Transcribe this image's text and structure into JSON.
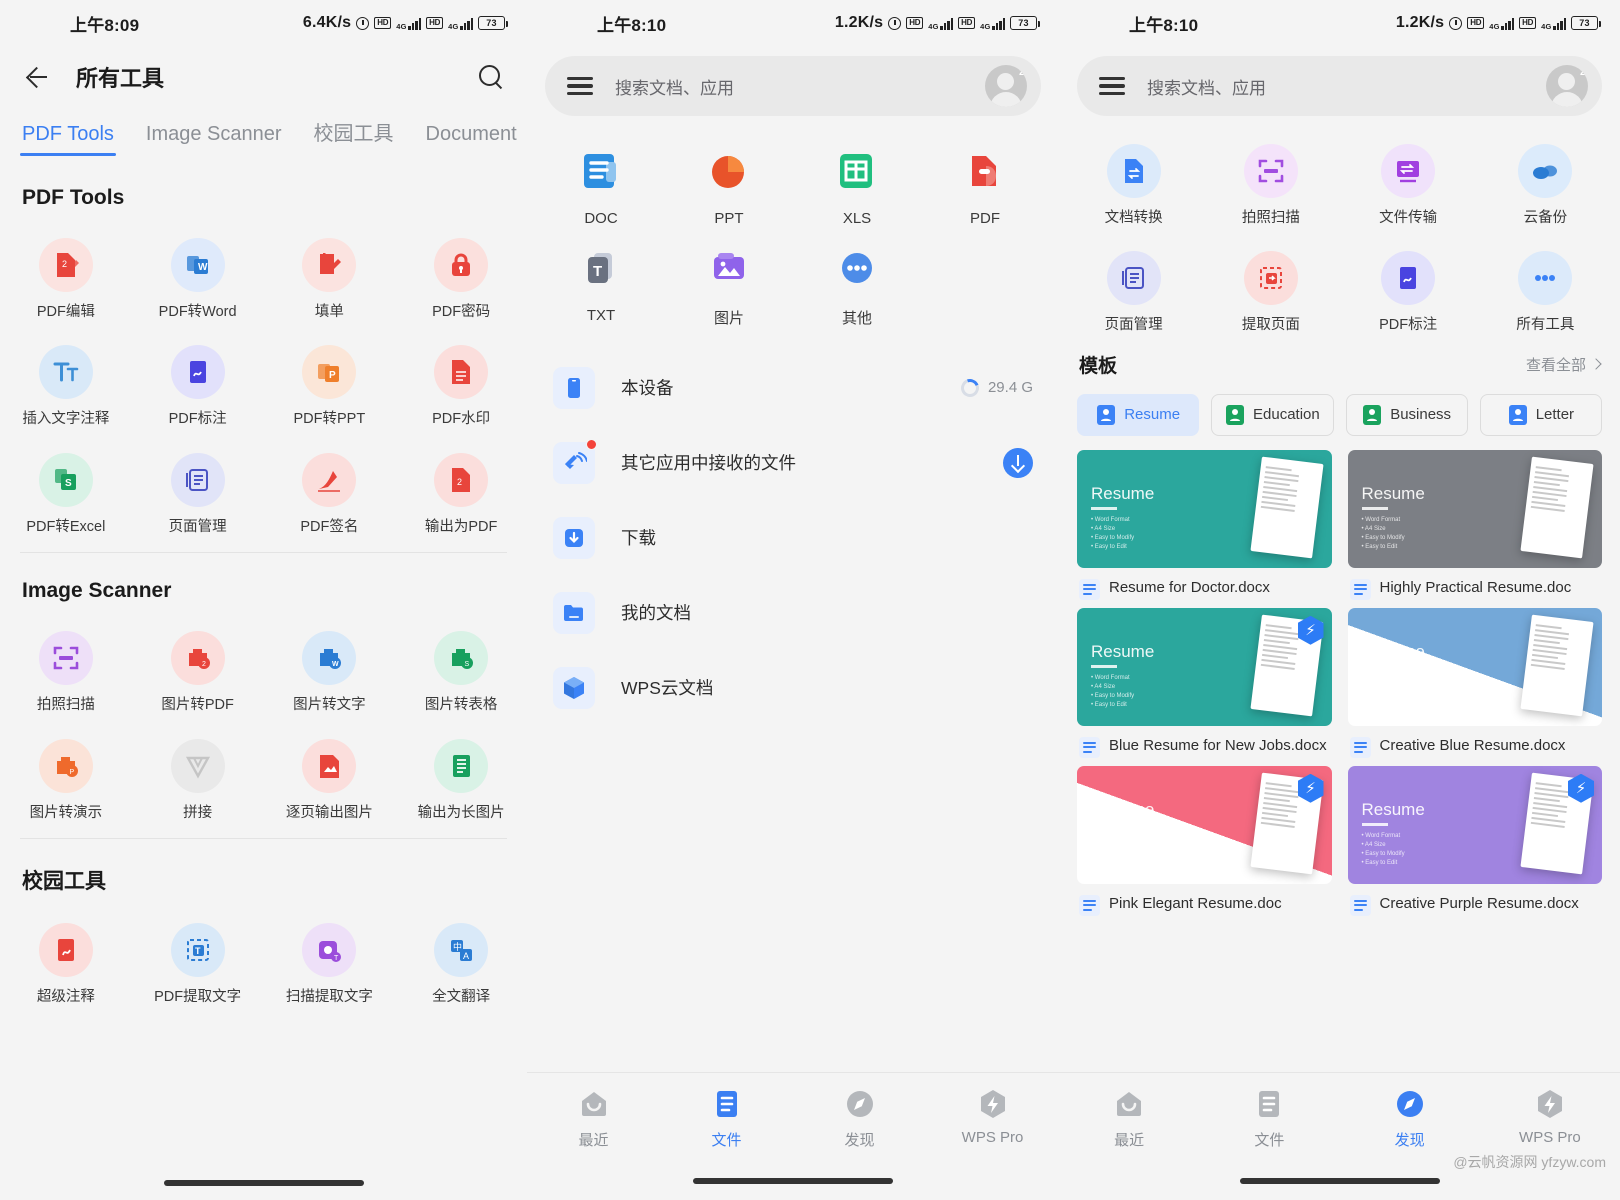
{
  "panel1": {
    "status": {
      "time": "上午8:09",
      "speed": "6.4K/s",
      "network1": "4G",
      "network2": "4G",
      "hd": "HD",
      "battery": "73"
    },
    "appbar": {
      "title": "所有工具",
      "back_icon": "back-arrow-icon",
      "search_icon": "search-icon"
    },
    "tabs": [
      {
        "label": "PDF Tools",
        "active": true
      },
      {
        "label": "Image Scanner",
        "active": false
      },
      {
        "label": "校园工具",
        "active": false
      },
      {
        "label": "Document",
        "active": false
      }
    ],
    "sections": [
      {
        "title": "PDF Tools",
        "tools": [
          {
            "label": "PDF编辑",
            "icon": "pdf-edit-icon",
            "bubble": "#fbe3e0",
            "color": "#e8453c"
          },
          {
            "label": "PDF转Word",
            "icon": "pdf-to-word-icon",
            "bubble": "#dfeafb",
            "color": "#2b7cd3"
          },
          {
            "label": "填单",
            "icon": "fill-form-icon",
            "bubble": "#fbe3e0",
            "color": "#e8453c"
          },
          {
            "label": "PDF密码",
            "icon": "lock-icon",
            "bubble": "#fbe0dd",
            "color": "#e8453c"
          },
          {
            "label": "插入文字注释",
            "icon": "insert-text-icon",
            "bubble": "#d9e9f8",
            "color": "#3d8fd6"
          },
          {
            "label": "PDF标注",
            "icon": "pdf-annotate-icon",
            "bubble": "#e2e1fb",
            "color": "#4a44e0"
          },
          {
            "label": "PDF转PPT",
            "icon": "pdf-to-ppt-icon",
            "bubble": "#fbe6d8",
            "color": "#ef7f2c"
          },
          {
            "label": "PDF水印",
            "icon": "watermark-icon",
            "bubble": "#fbdedc",
            "color": "#e8453c"
          },
          {
            "label": "PDF转Excel",
            "icon": "pdf-to-excel-icon",
            "bubble": "#d9f2e6",
            "color": "#18a05e"
          },
          {
            "label": "页面管理",
            "icon": "page-manage-icon",
            "bubble": "#e1e4f8",
            "color": "#4b54c4"
          },
          {
            "label": "PDF签名",
            "icon": "signature-icon",
            "bubble": "#fbdedc",
            "color": "#e8453c"
          },
          {
            "label": "输出为PDF",
            "icon": "export-pdf-icon",
            "bubble": "#fbdedc",
            "color": "#e8453c"
          }
        ]
      },
      {
        "title": "Image Scanner",
        "tools": [
          {
            "label": "拍照扫描",
            "icon": "scan-photo-icon",
            "bubble": "#eee0f8",
            "color": "#9b4ddb"
          },
          {
            "label": "图片转PDF",
            "icon": "image-to-pdf-icon",
            "bubble": "#fbdedc",
            "color": "#e8453c"
          },
          {
            "label": "图片转文字",
            "icon": "image-to-text-icon",
            "bubble": "#d9e9f8",
            "color": "#2b7cd3"
          },
          {
            "label": "图片转表格",
            "icon": "image-to-table-icon",
            "bubble": "#d9f2e6",
            "color": "#18a05e"
          },
          {
            "label": "图片转演示",
            "icon": "image-to-ppt-icon",
            "bubble": "#fbe3d8",
            "color": "#ef6a2c"
          },
          {
            "label": "拼接",
            "icon": "stitch-icon",
            "bubble": "#e9e9e9",
            "color": "#c5c5c5"
          },
          {
            "label": "逐页输出图片",
            "icon": "export-pages-image-icon",
            "bubble": "#fbdedc",
            "color": "#e8453c"
          },
          {
            "label": "输出为长图片",
            "icon": "export-long-image-icon",
            "bubble": "#d9f2e6",
            "color": "#18a05e"
          }
        ]
      },
      {
        "title": "校园工具",
        "tools": [
          {
            "label": "超级注释",
            "icon": "super-annotate-icon",
            "bubble": "#fbdedc",
            "color": "#e8453c"
          },
          {
            "label": "PDF提取文字",
            "icon": "pdf-extract-text-icon",
            "bubble": "#d9e9f8",
            "color": "#2b7cd3"
          },
          {
            "label": "扫描提取文字",
            "icon": "scan-extract-text-icon",
            "bubble": "#eee0f8",
            "color": "#9b4ddb"
          },
          {
            "label": "全文翻译",
            "icon": "translate-icon",
            "bubble": "#d9e9f8",
            "color": "#2b7cd3"
          }
        ]
      }
    ]
  },
  "panel2": {
    "status": {
      "time": "上午8:10",
      "speed": "1.2K/s",
      "network1": "4G",
      "network2": "4G",
      "hd": "HD",
      "battery": "73"
    },
    "search": {
      "placeholder": "搜索文档、应用",
      "menu_icon": "hamburger-icon",
      "avatar_icon": "avatar-sleep-icon"
    },
    "doc_types": [
      {
        "label": "DOC",
        "icon": "doc-icon"
      },
      {
        "label": "PPT",
        "icon": "ppt-icon"
      },
      {
        "label": "XLS",
        "icon": "xls-icon"
      },
      {
        "label": "PDF",
        "icon": "pdf-icon"
      },
      {
        "label": "TXT",
        "icon": "txt-icon"
      },
      {
        "label": "图片",
        "icon": "image-icon"
      },
      {
        "label": "其他",
        "icon": "more-dots-icon"
      }
    ],
    "files": [
      {
        "label": "本设备",
        "icon": "phone-icon",
        "right_value": "29.4 G",
        "right_type": "storage"
      },
      {
        "label": "其它应用中接收的文件",
        "icon": "receive-files-icon",
        "right_type": "download",
        "badge": true
      },
      {
        "label": "下载",
        "icon": "download-folder-icon",
        "right_type": "none"
      },
      {
        "label": "我的文档",
        "icon": "folder-icon",
        "right_type": "none"
      },
      {
        "label": "WPS云文档",
        "icon": "cloud-cube-icon",
        "right_type": "none"
      }
    ],
    "nav": [
      {
        "label": "最近",
        "icon": "recent-icon",
        "active": false
      },
      {
        "label": "文件",
        "icon": "files-icon",
        "active": true
      },
      {
        "label": "发现",
        "icon": "discover-icon",
        "active": false
      },
      {
        "label": "WPS Pro",
        "icon": "wps-pro-icon",
        "active": false
      }
    ]
  },
  "panel3": {
    "status": {
      "time": "上午8:10",
      "speed": "1.2K/s",
      "network1": "4G",
      "network2": "4G",
      "hd": "HD",
      "battery": "73"
    },
    "search": {
      "placeholder": "搜索文档、应用",
      "menu_icon": "hamburger-icon",
      "avatar_icon": "avatar-sleep-icon"
    },
    "tools": [
      {
        "label": "文档转换",
        "icon": "doc-convert-icon",
        "bubble": "#dceafa",
        "color": "#3b82f6"
      },
      {
        "label": "拍照扫描",
        "icon": "scan-photo-icon",
        "bubble": "#f4e3fa",
        "color": "#a14de0"
      },
      {
        "label": "文件传输",
        "icon": "file-transfer-icon",
        "bubble": "#f0e2fb",
        "color": "#a13fe0"
      },
      {
        "label": "云备份",
        "icon": "cloud-backup-icon",
        "bubble": "#dcebfb",
        "color": "#2b7cd3"
      },
      {
        "label": "页面管理",
        "icon": "page-manage-icon",
        "bubble": "#e2e4f8",
        "color": "#4b54c4"
      },
      {
        "label": "提取页面",
        "icon": "extract-pages-icon",
        "bubble": "#fbdedc",
        "color": "#e8453c"
      },
      {
        "label": "PDF标注",
        "icon": "pdf-annotate-icon",
        "bubble": "#e2e1fb",
        "color": "#4a44e0"
      },
      {
        "label": "所有工具",
        "icon": "all-tools-icon",
        "bubble": "#dceafa",
        "color": "#3b82f6"
      }
    ],
    "templates_header": {
      "title": "模板",
      "more_label": "查看全部",
      "chevron_icon": "chevron-right-icon"
    },
    "chips": [
      {
        "label": "Resume",
        "active": true,
        "color": "#3b82f6"
      },
      {
        "label": "Education",
        "active": false,
        "color": "#1aa35e"
      },
      {
        "label": "Business",
        "active": false,
        "color": "#1aa35e"
      },
      {
        "label": "Letter",
        "active": false,
        "color": "#3b82f6"
      }
    ],
    "templates": [
      {
        "name": "Resume for Doctor.docx",
        "bg": "#2ba79d",
        "heading": "Resume",
        "pro": false,
        "style": "flat"
      },
      {
        "name": "Highly Practical Resume.doc",
        "bg": "#7c7f85",
        "heading": "Resume",
        "pro": false,
        "style": "flat"
      },
      {
        "name": "Blue Resume for New Jobs.docx",
        "bg": "#2ba79d",
        "heading": "Resume",
        "pro": true,
        "style": "flat"
      },
      {
        "name": "Creative Blue Resume.docx",
        "bg": "#74a8d8",
        "heading": "Resume",
        "pro": false,
        "style": "diag"
      },
      {
        "name": "Pink Elegant Resume.doc",
        "bg": "#f4697f",
        "heading": "Resume",
        "pro": true,
        "style": "diag"
      },
      {
        "name": "Creative  Purple Resume.docx",
        "bg": "#a084e0",
        "heading": "Resume",
        "pro": true,
        "style": "flat"
      }
    ],
    "nav": [
      {
        "label": "最近",
        "icon": "recent-icon",
        "active": false
      },
      {
        "label": "文件",
        "icon": "files-icon",
        "active": false
      },
      {
        "label": "发现",
        "icon": "discover-icon",
        "active": true
      },
      {
        "label": "WPS Pro",
        "icon": "wps-pro-icon",
        "active": false
      }
    ],
    "watermark": "@云帆资源网 yfzyw.com"
  }
}
